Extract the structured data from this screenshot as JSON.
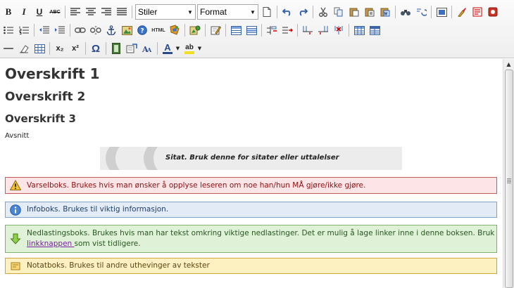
{
  "toolbar": {
    "styles_select": "Stiler",
    "format_select": "Format",
    "bold": "B",
    "italic": "I",
    "underline": "U",
    "strike": "ABC",
    "html_label": "HTML",
    "omega": "Ω",
    "subscript": "x₂",
    "superscript": "x²",
    "font_color_letter": "A",
    "highlight_letter": "ab"
  },
  "content": {
    "heading1": "Overskrift 1",
    "heading2": "Overskrift 2",
    "heading3": "Overskrift 3",
    "paragraph": "Avsnitt",
    "quote": "Sitat. Bruk denne for sitater eller uttalelser",
    "warning_box": "Varselboks. Brukes hvis man ønsker å opplyse leseren om noe han/hun MÅ gjøre/ikke gjøre.",
    "info_box": "Infoboks. Brukes til viktig informasjon.",
    "download_box_before": "Nedlastingsboks. Brukes hvis man har tekst omkring viktige nedlastinger. Det er mulig å lage linker inne i denne boksen. Bruk ",
    "download_box_link": "linkknappen ",
    "download_box_after": "som vist tidligere.",
    "note_box": "Notatboks. Brukes til andre uthevinger av tekster"
  },
  "colors": {
    "warning_bg": "#fde5e7",
    "info_bg": "#e3ecf6",
    "download_bg": "#dff2d8",
    "note_bg": "#fdf1c2",
    "link": "#7a1fa0"
  }
}
